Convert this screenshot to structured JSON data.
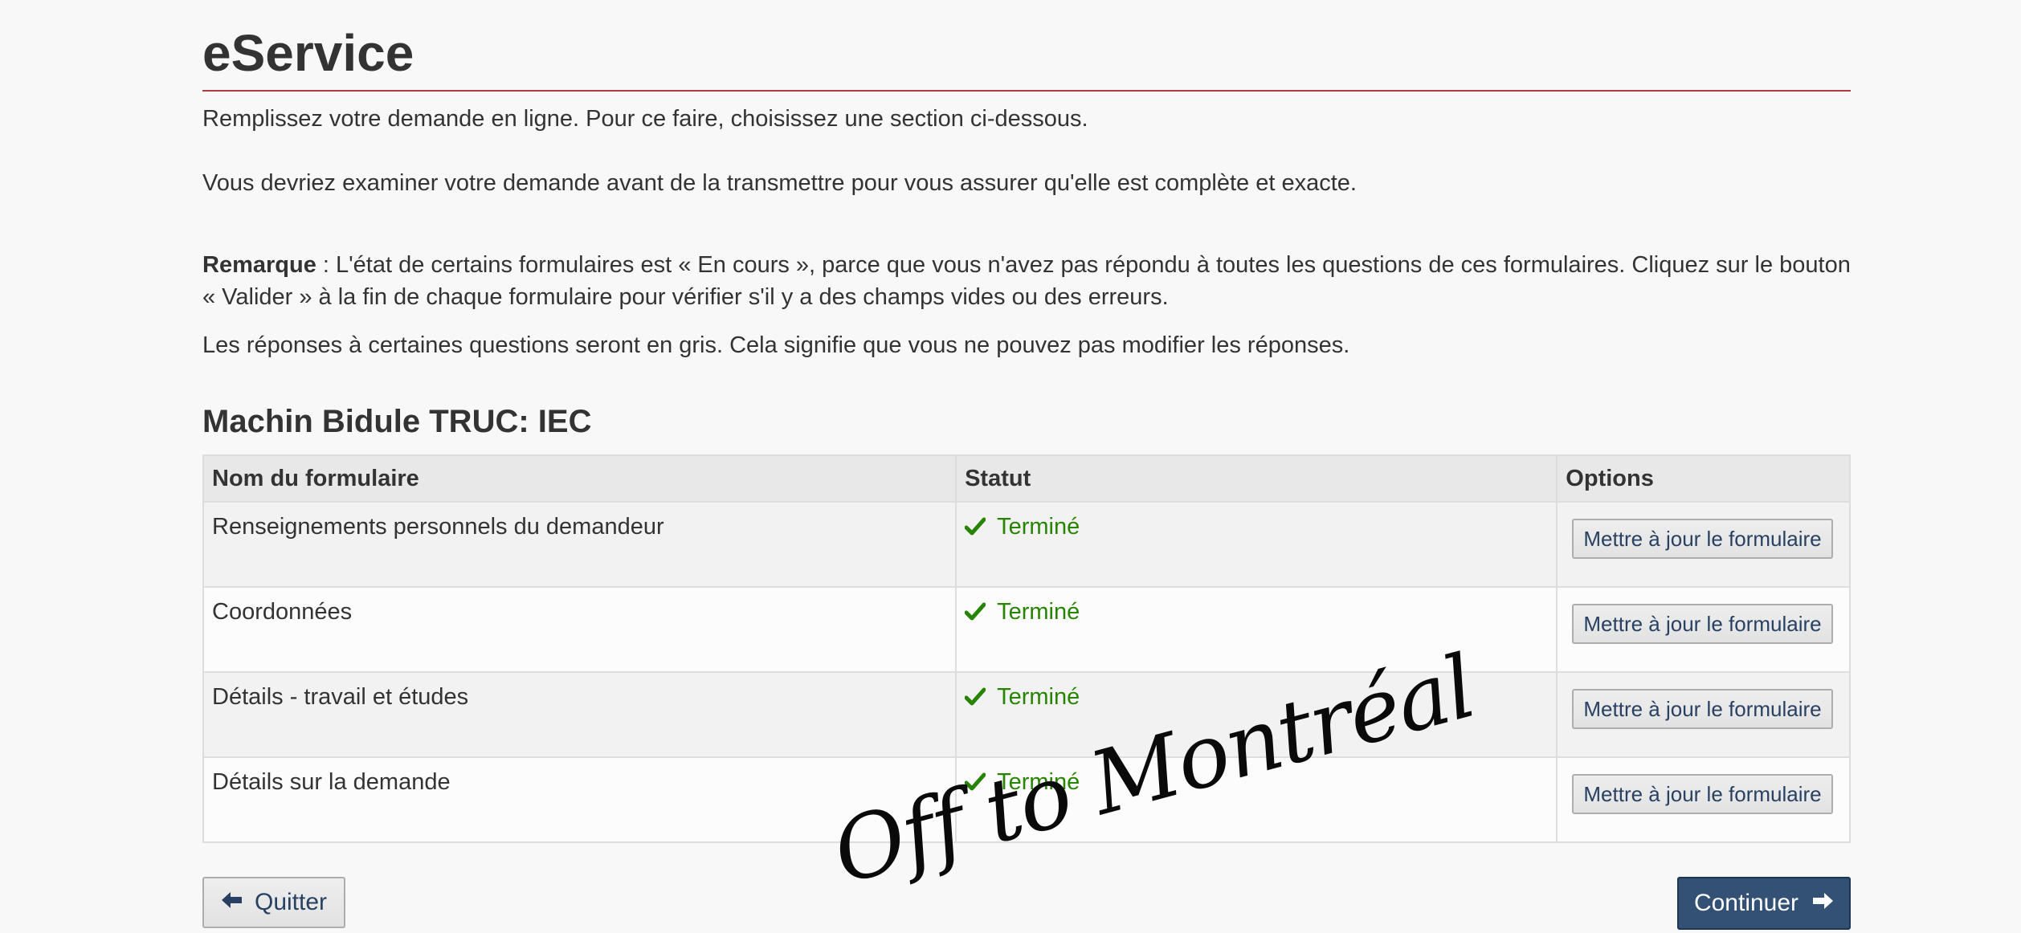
{
  "header": {
    "title": "eService"
  },
  "intro": {
    "line1": "Remplissez votre demande en ligne. Pour ce faire, choisissez une section ci-dessous.",
    "line2": "Vous devriez examiner votre demande avant de la transmettre pour vous assurer qu'elle est complète et exacte.",
    "note_label": "Remarque",
    "note_text": " : L'état de certains formulaires est « En cours », parce que vous n'avez pas répondu à toutes les questions de ces formulaires. Cliquez sur le bouton « Valider » à la fin de chaque formulaire pour vérifier s'il y a des champs vides ou des erreurs.",
    "line4": "Les réponses à certaines questions seront en gris. Cela signifie que vous ne pouvez pas modifier les réponses."
  },
  "section": {
    "title": "Machin Bidule TRUC: IEC"
  },
  "table": {
    "headers": [
      "Nom du formulaire",
      "Statut",
      "Options"
    ],
    "rows": [
      {
        "name": "Renseignements personnels du demandeur",
        "status": "Terminé",
        "action": "Mettre à jour le formulaire"
      },
      {
        "name": "Coordonnées",
        "status": "Terminé",
        "action": "Mettre à jour le formulaire"
      },
      {
        "name": "Détails - travail et études",
        "status": "Terminé",
        "action": "Mettre à jour le formulaire"
      },
      {
        "name": "Détails sur la demande",
        "status": "Terminé",
        "action": "Mettre à jour le formulaire"
      }
    ]
  },
  "footer": {
    "quit_label": "Quitter",
    "continue_label": "Continuer"
  },
  "watermark": {
    "text": "Off to Montréal"
  },
  "colors": {
    "accent_rule": "#af3c43",
    "status_done": "#278400",
    "primary_button": "#335075",
    "link_text": "#284162"
  },
  "icons": {
    "status": "checkmark-icon",
    "quit": "arrow-left-icon",
    "continue": "arrow-right-icon"
  }
}
